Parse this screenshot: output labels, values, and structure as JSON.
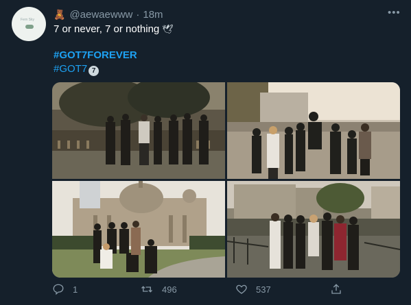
{
  "user": {
    "handle": "@aewaewww",
    "time": "18m",
    "separator": "·",
    "avatar_text": "Fern Sky"
  },
  "tweet": {
    "text": "7 or never, 7 or nothing",
    "dove_emoji": "🕊",
    "hashtags": [
      "#GOT7FOREVER",
      "#GOT7"
    ],
    "got7_emoji_label": "7"
  },
  "photos": [
    {
      "icon": "group-back-view-photo"
    },
    {
      "icon": "group-on-railing-photo"
    },
    {
      "icon": "cathedral-group-photo"
    },
    {
      "icon": "riverside-group-photo"
    }
  ],
  "actions": {
    "reply_count": "1",
    "retweet_count": "496",
    "like_count": "537",
    "more_glyph": "•••"
  },
  "colors": {
    "background": "#15202b",
    "hashtag": "#1da1f2",
    "muted": "#8899a6"
  }
}
